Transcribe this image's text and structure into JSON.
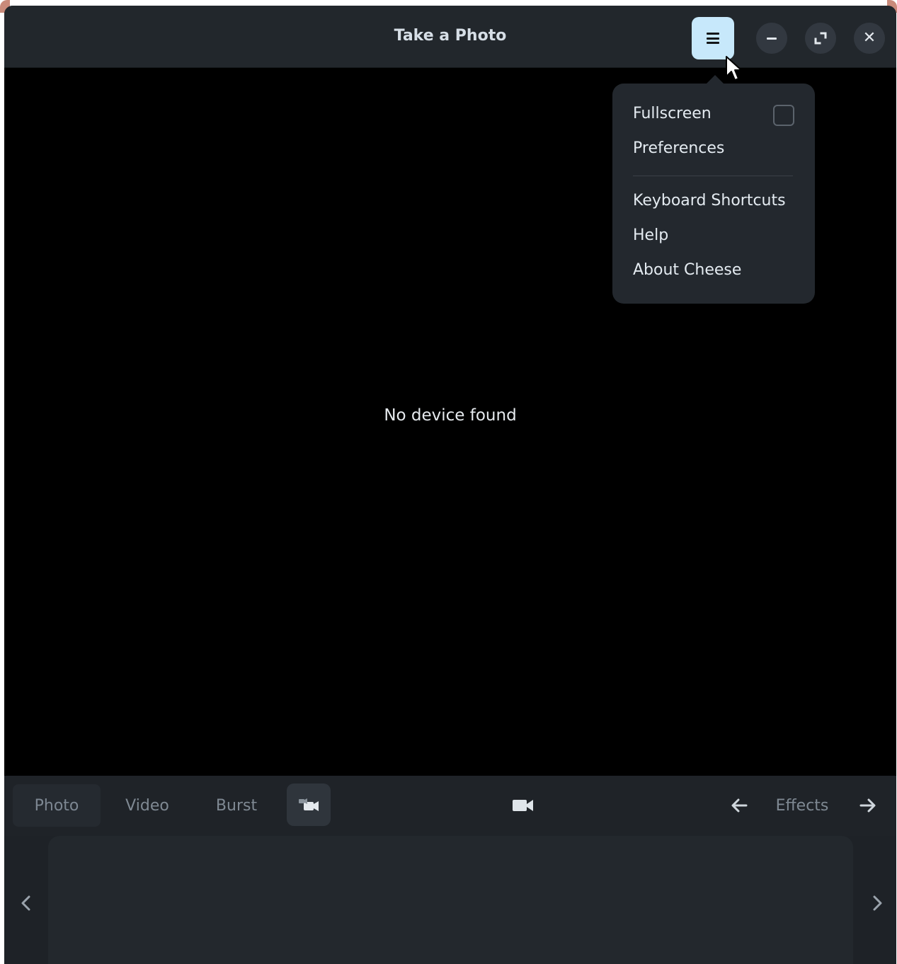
{
  "window": {
    "title": "Take a Photo"
  },
  "headerbar": {
    "menu_icon": "hamburger-icon",
    "minimize_icon": "minimize-icon",
    "maximize_icon": "maximize-icon",
    "close_icon": "close-icon",
    "close_glyph": "✕"
  },
  "menu": {
    "items": [
      {
        "label": "Fullscreen",
        "has_checkbox": true,
        "checked": false
      },
      {
        "label": "Preferences"
      },
      {
        "label": "Keyboard Shortcuts"
      },
      {
        "label": "Help"
      },
      {
        "label": "About Cheese"
      }
    ]
  },
  "viewport": {
    "message": "No device found"
  },
  "modes": {
    "tabs": [
      {
        "label": "Photo",
        "active": true
      },
      {
        "label": "Video",
        "active": false
      },
      {
        "label": "Burst",
        "active": false
      }
    ],
    "switch_camera_icon": "switch-camera-icon",
    "record_icon": "video-camera-icon"
  },
  "effects": {
    "label": "Effects",
    "prev_icon": "arrow-left-icon",
    "next_icon": "arrow-right-icon"
  },
  "thumbnails": {
    "prev_icon": "chevron-left-icon",
    "next_icon": "chevron-right-icon"
  },
  "colors": {
    "accent_button": "#c7e8fb",
    "window_bg": "#1e2227",
    "viewport_bg": "#000000"
  }
}
